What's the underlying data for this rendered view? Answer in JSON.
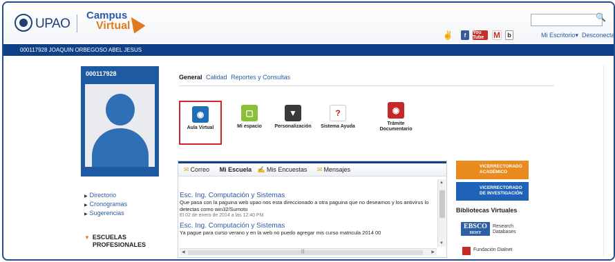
{
  "header": {
    "upao_logo_text": "UPAO",
    "campus_text": "Campus",
    "virtual_text": "Virtual",
    "search_placeholder": "",
    "social": {
      "youtube": "You Tube",
      "gmail": "M",
      "blog": "b",
      "facebook": "f"
    },
    "nav": {
      "escritorio": "Mi Escritorio▾",
      "desconectar": "Desconectar"
    }
  },
  "user": {
    "code_name": "000117928   JOAQUIN ORBEGOSO ABEL JESUS"
  },
  "profile": {
    "code": "000117928"
  },
  "left_links": [
    "Directorio",
    "Cronogramas",
    "Sugerencias"
  ],
  "escuelas": {
    "line1": "ESCUELAS",
    "line2": "PROFESIONALES"
  },
  "tabs": [
    "General",
    "Calidad",
    "Reportes y Consultas"
  ],
  "apps": [
    {
      "label": "Aula Virtual"
    },
    {
      "label": "Mi espacio"
    },
    {
      "label": "Personalización"
    },
    {
      "label": "Sistema Ayuda"
    },
    {
      "label_line1": "Trámite",
      "label_line2": "Documentario"
    }
  ],
  "messages": {
    "tabs": [
      "Correo",
      "Mi Escuela",
      "Mis Encuestas",
      "Mensajes"
    ],
    "items": [
      {
        "title": "Esc. Ing. Computación y Sistemas",
        "body": "Que pasa con la paguina web upao nos esta direccionado a otra paguina que no deseamos y los antivirus lo detectas como win32/Sumoto",
        "date": "El 02 de enero de 2014 a las 12:40 PM"
      },
      {
        "title": "Esc. Ing. Computación y Sistemas",
        "body": "Ya pague para curso verano y en la web no puedo agregar mis curso matricula 2014 00",
        "date": ""
      }
    ]
  },
  "right": {
    "banner_academico": "VICERRECTORADO ACADÉMICO",
    "banner_investigacion": "VICERRECTORADO DE INVESTIGACIÓN",
    "bibliotecas": "Bibliotecas Virtuales",
    "ebsco": "EBSCO",
    "ebsco_host": "HOST",
    "ebsco_sub1": "Research",
    "ebsco_sub2": "Databases",
    "dialnet": "Fundación Dialnet"
  },
  "colors": {
    "brand_blue": "#0f3f86",
    "accent_orange": "#e07a1d",
    "highlight_red": "#d42128"
  }
}
